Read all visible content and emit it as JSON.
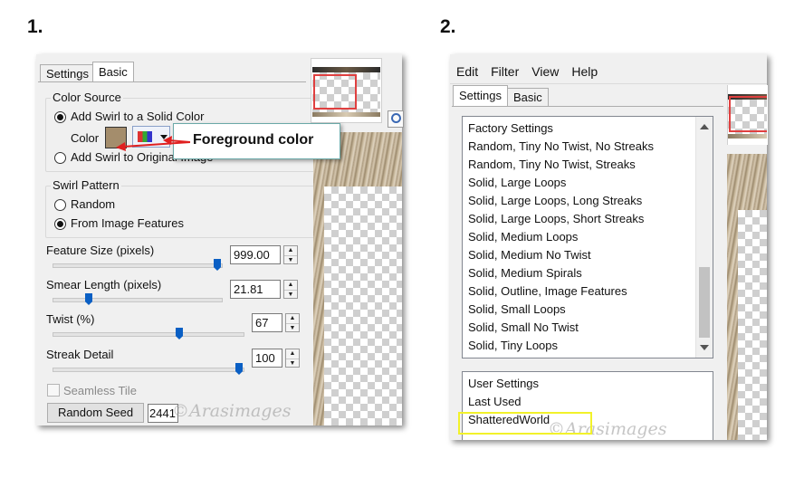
{
  "step1": {
    "number": "1.",
    "tabs": [
      "Settings",
      "Basic"
    ],
    "color_source": {
      "title": "Color Source",
      "option1": "Add Swirl to a Solid Color",
      "color_label": "Color",
      "swatch_color": "#a48d6c",
      "option2": "Add Swirl to Original Image"
    },
    "callout": "Foreground color",
    "swirl_pattern": {
      "title": "Swirl Pattern",
      "option1": "Random",
      "option2": "From Image Features"
    },
    "feature_size": {
      "label": "Feature Size (pixels)",
      "value": "999.00",
      "level": 1.0
    },
    "smear_length": {
      "label": "Smear Length (pixels)",
      "value": "21.81",
      "level": 0.22
    },
    "twist": {
      "label": "Twist (%)",
      "value": "67",
      "level": 0.67
    },
    "streak_detail": {
      "label": "Streak Detail",
      "value": "100",
      "level": 1.0
    },
    "seamless_tile": "Seamless Tile",
    "random_seed_button": "Random Seed",
    "random_seed_value": "2441",
    "watermark": "©Arasimages"
  },
  "step2": {
    "number": "2.",
    "menu": [
      "Edit",
      "Filter",
      "View",
      "Help"
    ],
    "tabs": [
      "Settings",
      "Basic"
    ],
    "factory_header": "Factory Settings",
    "factory_items": [
      "Random, Tiny No Twist, No Streaks",
      "Random, Tiny No Twist, Streaks",
      "Solid, Large Loops",
      "Solid, Large Loops, Long Streaks",
      "Solid, Large Loops, Short Streaks",
      "Solid, Medium Loops",
      "Solid, Medium No Twist",
      "Solid, Medium Spirals",
      "Solid, Outline, Image Features",
      "Solid, Small Loops",
      "Solid, Small No Twist",
      "Solid, Tiny Loops"
    ],
    "user_header": "User Settings",
    "user_items": [
      "Last Used",
      "ShatteredWorld"
    ],
    "watermark": "©Arasimages"
  },
  "colors": {
    "highlight_box": "#f2f22a",
    "arrow": "#e02020",
    "preview_frame": "#e04040",
    "slider_thumb": "#0a5fc4"
  }
}
